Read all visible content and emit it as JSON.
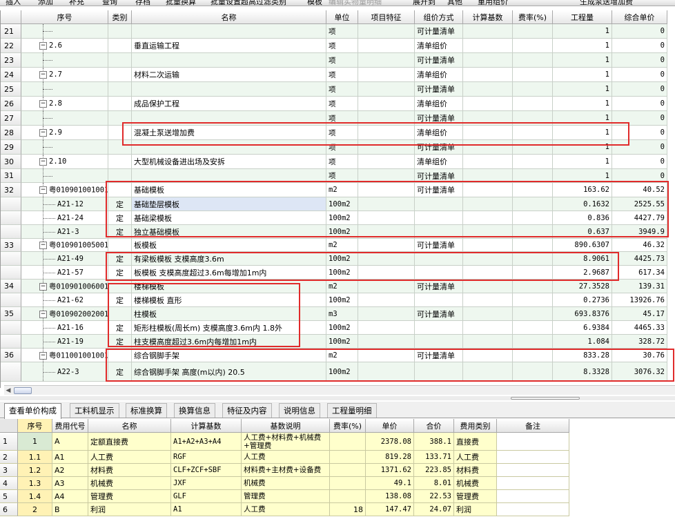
{
  "toolbar": {
    "items": [
      {
        "label": "插入",
        "enabled": true
      },
      {
        "label": "添加",
        "enabled": true
      },
      {
        "label": "补充",
        "enabled": true
      },
      {
        "label": "查询",
        "enabled": true
      },
      {
        "label": "存档",
        "enabled": true
      },
      {
        "label": "批量换算",
        "enabled": true
      },
      {
        "label": "批量设置超高过滤类别",
        "enabled": true
      },
      {
        "label": "模板",
        "enabled": true
      },
      {
        "label": "编辑实物量明细",
        "enabled": false
      },
      {
        "label": "展开到",
        "enabled": true
      },
      {
        "label": "其他",
        "enabled": true
      },
      {
        "label": "重用组价",
        "enabled": true
      },
      {
        "label": "生成泵送增加费",
        "enabled": true
      }
    ]
  },
  "upper_grid": {
    "columns": [
      "序号",
      "类别",
      "名称",
      "单位",
      "项目特征",
      "组价方式",
      "计算基数",
      "费率(%)",
      "工程量",
      "综合单价"
    ],
    "rows": [
      {
        "idx": "21",
        "code": "",
        "level": "child",
        "type": "",
        "name": "",
        "unit": "项",
        "method": "可计量清单",
        "qty": "1",
        "price": "0"
      },
      {
        "idx": "22",
        "code": "2.6",
        "level": "group",
        "type": "",
        "name": "垂直运输工程",
        "unit": "项",
        "method": "清单组价",
        "qty": "1",
        "price": "0"
      },
      {
        "idx": "23",
        "code": "",
        "level": "child",
        "type": "",
        "name": "",
        "unit": "项",
        "method": "可计量清单",
        "qty": "1",
        "price": "0"
      },
      {
        "idx": "24",
        "code": "2.7",
        "level": "group",
        "type": "",
        "name": "材料二次运输",
        "unit": "项",
        "method": "清单组价",
        "qty": "1",
        "price": "0"
      },
      {
        "idx": "25",
        "code": "",
        "level": "child",
        "type": "",
        "name": "",
        "unit": "项",
        "method": "可计量清单",
        "qty": "1",
        "price": "0"
      },
      {
        "idx": "26",
        "code": "2.8",
        "level": "group",
        "type": "",
        "name": "成品保护工程",
        "unit": "项",
        "method": "清单组价",
        "qty": "1",
        "price": "0"
      },
      {
        "idx": "27",
        "code": "",
        "level": "child",
        "type": "",
        "name": "",
        "unit": "项",
        "method": "可计量清单",
        "qty": "1",
        "price": "0"
      },
      {
        "idx": "28",
        "code": "2.9",
        "level": "group",
        "type": "",
        "name": "混凝土泵送增加费",
        "unit": "项",
        "method": "清单组价",
        "qty": "1",
        "price": "0"
      },
      {
        "idx": "29",
        "code": "",
        "level": "child",
        "type": "",
        "name": "",
        "unit": "项",
        "method": "可计量清单",
        "qty": "1",
        "price": "0"
      },
      {
        "idx": "30",
        "code": "2.10",
        "level": "group",
        "type": "",
        "name": "大型机械设备进出场及安拆",
        "unit": "项",
        "method": "清单组价",
        "qty": "1",
        "price": "0"
      },
      {
        "idx": "31",
        "code": "",
        "level": "child",
        "type": "",
        "name": "",
        "unit": "项",
        "method": "可计量清单",
        "qty": "1",
        "price": "0"
      },
      {
        "idx": "32",
        "code": "粤010901001001",
        "level": "group",
        "type": "",
        "name": "基础模板",
        "unit": "m2",
        "method": "可计量清单",
        "qty": "163.62",
        "price": "40.52"
      },
      {
        "idx": "",
        "code": "A21-12",
        "level": "sub",
        "type": "定",
        "name": "基础垫层模板",
        "unit": "100m2",
        "method": "",
        "qty": "0.1632",
        "price": "2525.55",
        "selected": true
      },
      {
        "idx": "",
        "code": "A21-24",
        "level": "sub",
        "type": "定",
        "name": "基础梁模板",
        "unit": "100m2",
        "method": "",
        "qty": "0.836",
        "price": "4427.79"
      },
      {
        "idx": "",
        "code": "A21-3",
        "level": "sub",
        "type": "定",
        "name": "独立基础模板",
        "unit": "100m2",
        "method": "",
        "qty": "0.637",
        "price": "3949.9"
      },
      {
        "idx": "33",
        "code": "粤010901005001",
        "level": "group",
        "type": "",
        "name": "板模板",
        "unit": "m2",
        "method": "可计量清单",
        "qty": "890.6307",
        "price": "46.32"
      },
      {
        "idx": "",
        "code": "A21-49",
        "level": "sub",
        "type": "定",
        "name": "有梁板模板 支模高度3.6m",
        "unit": "100m2",
        "method": "",
        "qty": "8.9061",
        "price": "4425.73"
      },
      {
        "idx": "",
        "code": "A21-57",
        "level": "sub",
        "type": "定",
        "name": "板模板 支模高度超过3.6m每增加1m内",
        "unit": "100m2",
        "method": "",
        "qty": "2.9687",
        "price": "617.34"
      },
      {
        "idx": "34",
        "code": "粤010901006001",
        "level": "group",
        "type": "",
        "name": "楼梯模板",
        "unit": "m2",
        "method": "可计量清单",
        "qty": "27.3528",
        "price": "139.31"
      },
      {
        "idx": "",
        "code": "A21-62",
        "level": "sub",
        "type": "定",
        "name": "楼梯模板 直形",
        "unit": "100m2",
        "method": "",
        "qty": "0.2736",
        "price": "13926.76"
      },
      {
        "idx": "35",
        "code": "粤010902002001",
        "level": "group",
        "type": "",
        "name": "柱模板",
        "unit": "m3",
        "method": "可计量清单",
        "qty": "693.8376",
        "price": "45.17"
      },
      {
        "idx": "",
        "code": "A21-16",
        "level": "sub",
        "type": "定",
        "name": "矩形柱模板(周长m) 支模高度3.6m内 1.8外",
        "unit": "100m2",
        "method": "",
        "qty": "6.9384",
        "price": "4465.33"
      },
      {
        "idx": "",
        "code": "A21-19",
        "level": "sub",
        "type": "定",
        "name": "柱支模高度超过3.6m内每增加1m内",
        "unit": "100m2",
        "method": "",
        "qty": "1.084",
        "price": "328.72"
      },
      {
        "idx": "36",
        "code": "粤011001001001",
        "level": "group",
        "type": "",
        "name": "综合钢脚手架",
        "unit": "m2",
        "method": "可计量清单",
        "qty": "833.28",
        "price": "30.76"
      },
      {
        "idx": "",
        "code": "A22-3",
        "level": "sub",
        "type": "定",
        "name": "综合钢脚手架 高度(m以内) 20.5",
        "unit": "100m2",
        "method": "",
        "qty": "8.3328",
        "price": "3076.32"
      }
    ]
  },
  "tabs": [
    {
      "label": "查看单价构成",
      "active": true
    },
    {
      "label": "工料机显示",
      "active": false
    },
    {
      "label": "标准换算",
      "active": false
    },
    {
      "label": "换算信息",
      "active": false
    },
    {
      "label": "特征及内容",
      "active": false
    },
    {
      "label": "说明信息",
      "active": false
    },
    {
      "label": "工程量明细",
      "active": false
    }
  ],
  "lower_grid": {
    "columns": [
      "序号",
      "费用代号",
      "名称",
      "计算基数",
      "基数说明",
      "费率(%)",
      "单价",
      "合价",
      "费用类别",
      "备注"
    ],
    "rows": [
      {
        "idx": "1",
        "seq": "1",
        "code": "A",
        "name": "定额直接费",
        "base": "A1+A2+A3+A4",
        "desc": "人工费+材料费+机械费+管理费",
        "rate": "",
        "unit_price": "2378.08",
        "total": "388.1",
        "category": "直接费",
        "note": ""
      },
      {
        "idx": "2",
        "seq": "1.1",
        "code": "A1",
        "name": "人工费",
        "base": "RGF",
        "desc": "人工费",
        "rate": "",
        "unit_price": "819.28",
        "total": "133.71",
        "category": "人工费",
        "note": ""
      },
      {
        "idx": "3",
        "seq": "1.2",
        "code": "A2",
        "name": "材料费",
        "base": "CLF+ZCF+SBF",
        "desc": "材料费+主材费+设备费",
        "rate": "",
        "unit_price": "1371.62",
        "total": "223.85",
        "category": "材料费",
        "note": ""
      },
      {
        "idx": "4",
        "seq": "1.3",
        "code": "A3",
        "name": "机械费",
        "base": "JXF",
        "desc": "机械费",
        "rate": "",
        "unit_price": "49.1",
        "total": "8.01",
        "category": "机械费",
        "note": ""
      },
      {
        "idx": "5",
        "seq": "1.4",
        "code": "A4",
        "name": "管理费",
        "base": "GLF",
        "desc": "管理费",
        "rate": "",
        "unit_price": "138.08",
        "total": "22.53",
        "category": "管理费",
        "note": ""
      },
      {
        "idx": "6",
        "seq": "2",
        "code": "B",
        "name": "利润",
        "base": "A1",
        "desc": "人工费",
        "rate": "18",
        "unit_price": "147.47",
        "total": "24.07",
        "category": "利润",
        "note": ""
      }
    ]
  },
  "colors": {
    "row_tint": "#eef7ef",
    "selected_cell": "#dde6f5",
    "highlight_box": "#e02a2a",
    "lower_data_bg": "#ffffcc"
  }
}
